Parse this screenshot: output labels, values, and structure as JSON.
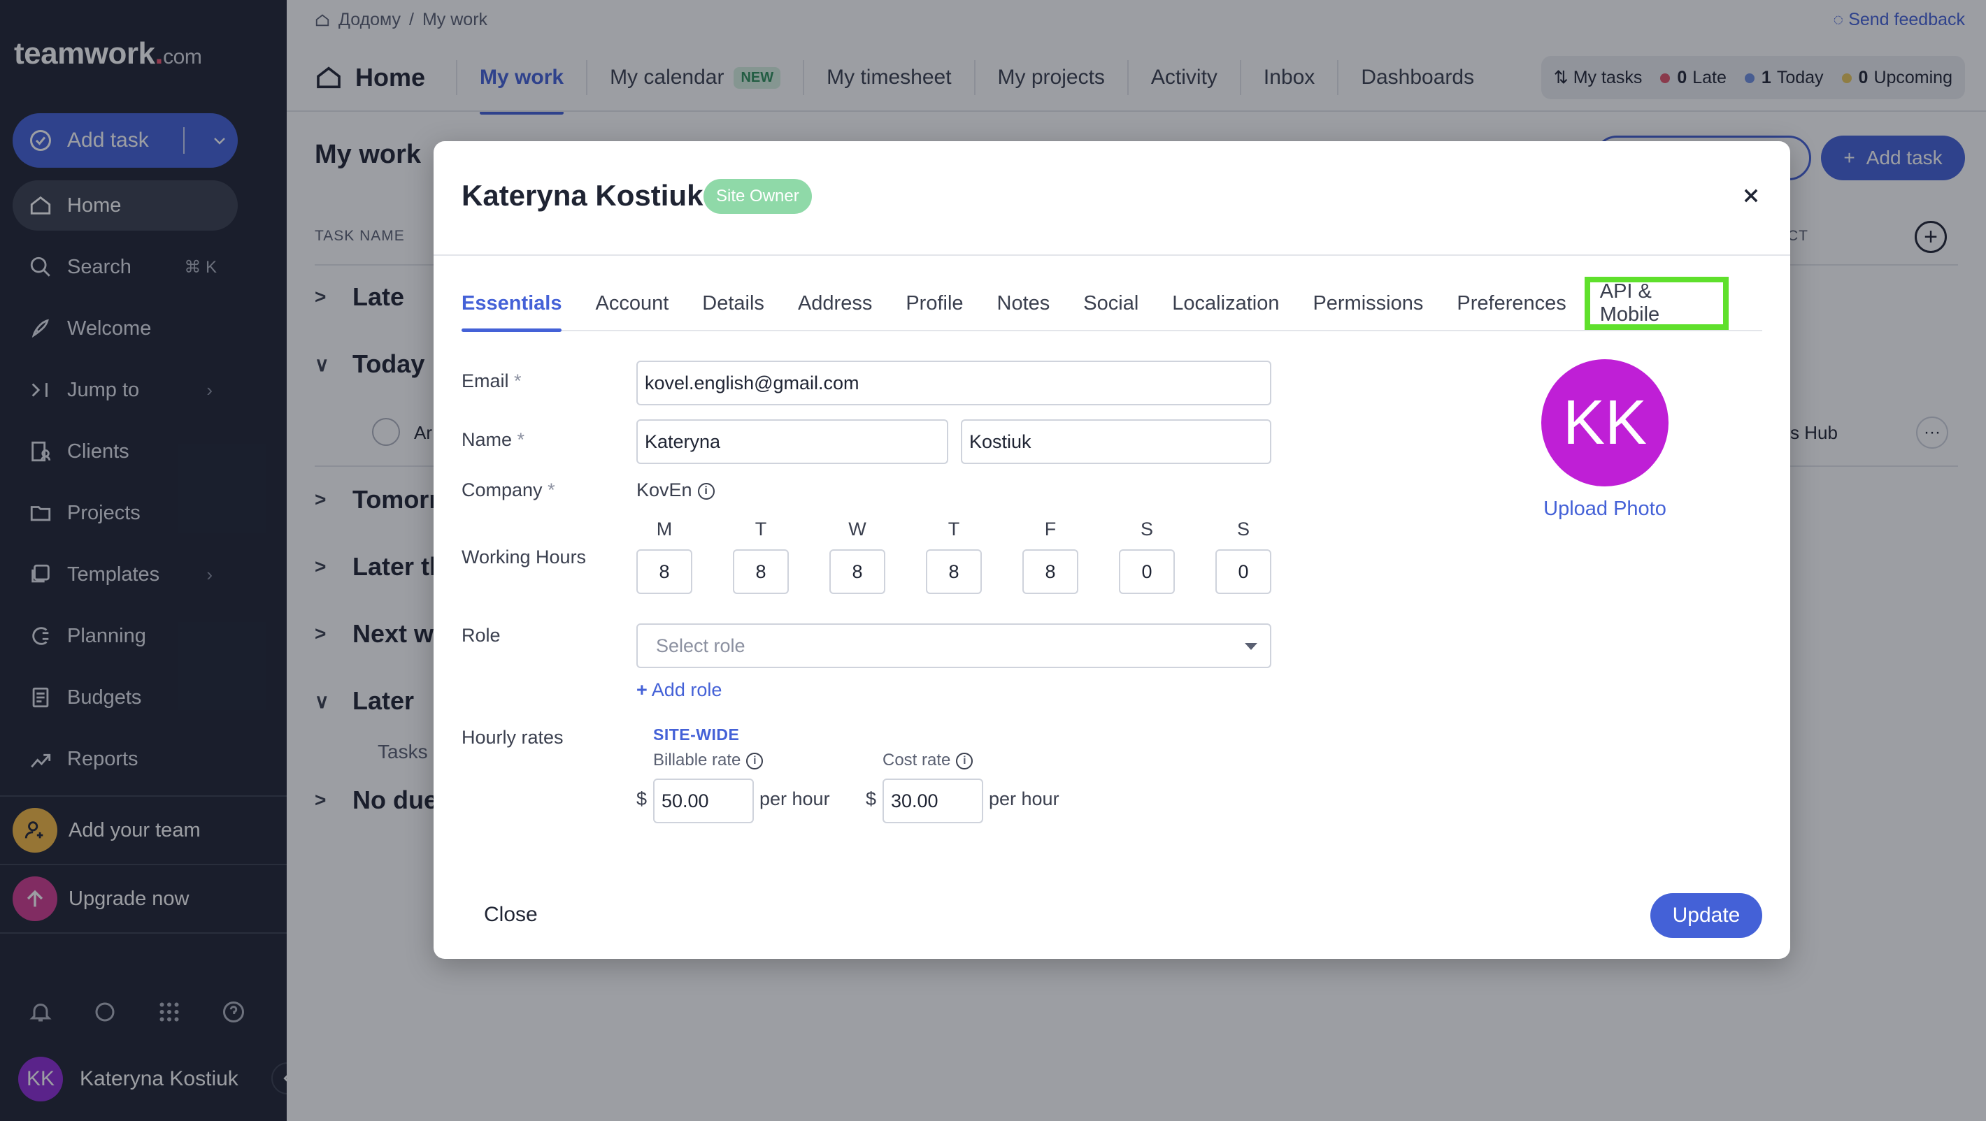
{
  "sidebar": {
    "logo": "teamwork",
    "logo_dot": ".",
    "logo_suffix": "com",
    "add_task": "Add task",
    "items": [
      {
        "label": "Home",
        "icon": "home-icon"
      },
      {
        "label": "Search",
        "icon": "search-icon",
        "shortcut": "⌘ K"
      },
      {
        "label": "Welcome",
        "icon": "rocket-icon"
      },
      {
        "label": "Jump to",
        "icon": "jump-icon"
      },
      {
        "label": "Clients",
        "icon": "clients-icon"
      },
      {
        "label": "Projects",
        "icon": "folder-icon"
      },
      {
        "label": "Templates",
        "icon": "templates-icon"
      },
      {
        "label": "Planning",
        "icon": "planning-icon"
      },
      {
        "label": "Budgets",
        "icon": "budget-icon"
      },
      {
        "label": "Reports",
        "icon": "reports-icon"
      }
    ],
    "add_team": "Add your team",
    "upgrade": "Upgrade now",
    "user_initials": "KK",
    "user_name": "Kateryna Kostiuk"
  },
  "header": {
    "breadcrumb_home": "Додому",
    "breadcrumb_sep": "/",
    "breadcrumb_current": "My work",
    "feedback": "Send feedback",
    "home": "Home",
    "tabs": [
      "My work",
      "My calendar",
      "My timesheet",
      "My projects",
      "Activity",
      "Inbox",
      "Dashboards"
    ],
    "new_badge": "NEW",
    "my_tasks": "My tasks",
    "late_count": "0",
    "late_label": "Late",
    "today_count": "1",
    "today_label": "Today",
    "upcoming_count": "0",
    "upcoming_label": "Upcoming"
  },
  "main": {
    "title": "My work",
    "add_task": "Add task",
    "col_task": "TASK NAME",
    "col_project": "CT",
    "groups": [
      "Late",
      "Today",
      "Tomorr",
      "Later th",
      "Next w",
      "Later",
      "No due"
    ],
    "task_fragment": "Ar",
    "project_fragment": "s Hub",
    "tasks_note": "Tasks"
  },
  "modal": {
    "title": "Kateryna Kostiuk",
    "badge": "Site Owner",
    "tabs": [
      "Essentials",
      "Account",
      "Details",
      "Address",
      "Profile",
      "Notes",
      "Social",
      "Localization",
      "Permissions",
      "Preferences",
      "API & Mobile"
    ],
    "email_label": "Email",
    "email": "kovel.english@gmail.com",
    "name_label": "Name",
    "first_name": "Kateryna",
    "last_name": "Kostiuk",
    "company_label": "Company",
    "company": "KovEn",
    "working_hours_label": "Working Hours",
    "days": [
      "M",
      "T",
      "W",
      "T",
      "F",
      "S",
      "S"
    ],
    "hours": [
      "8",
      "8",
      "8",
      "8",
      "8",
      "0",
      "0"
    ],
    "role_label": "Role",
    "role_placeholder": "Select role",
    "add_role": "Add role",
    "hourly_label": "Hourly rates",
    "site_wide": "SITE-WIDE",
    "billable_label": "Billable rate",
    "cost_label": "Cost rate",
    "currency": "$",
    "billable_rate": "50.00",
    "cost_rate": "30.00",
    "per_hour": "per hour",
    "avatar_initials": "KK",
    "upload_photo": "Upload Photo",
    "close": "Close",
    "update": "Update",
    "required_mark": "*"
  },
  "colors": {
    "accent": "#4461d7",
    "sidebar": "#1f2433",
    "avatar": "#bf1fd6",
    "badge": "#8fd9a8",
    "highlight": "#5fe02c"
  }
}
